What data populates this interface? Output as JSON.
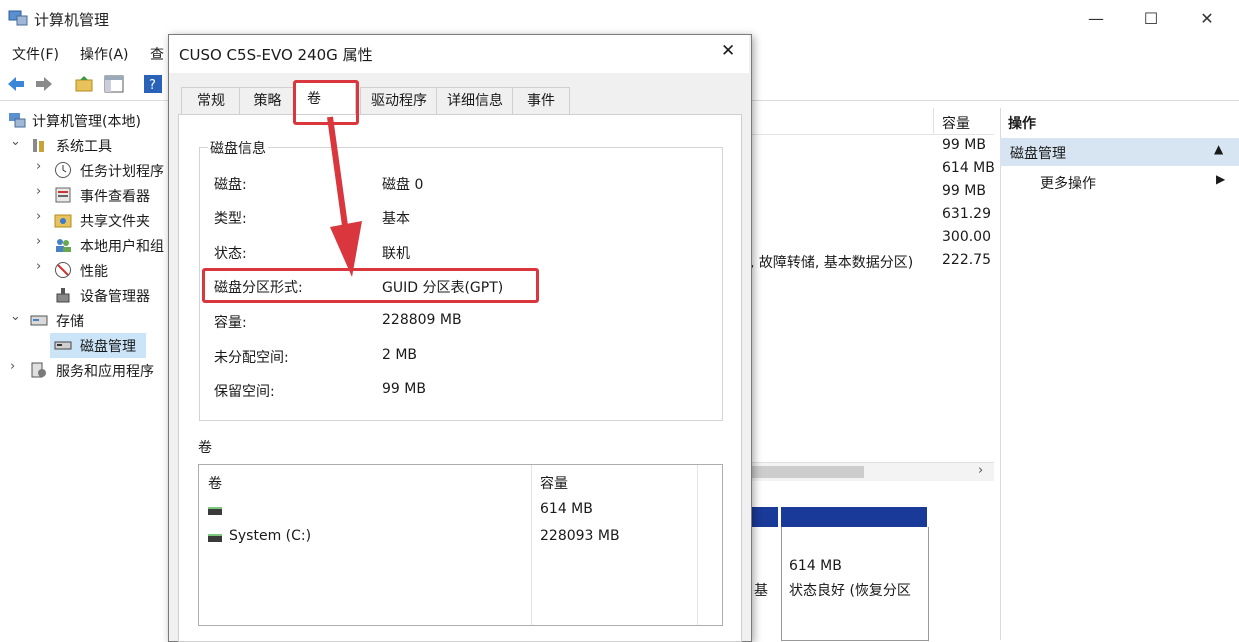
{
  "window": {
    "title": "计算机管理",
    "controls": {
      "minimize": "—",
      "maximize": "☐",
      "close": "✕"
    }
  },
  "menu": {
    "file": "文件(F)",
    "action": "操作(A)",
    "view_partial": "查"
  },
  "tree": [
    {
      "label": "计算机管理(本地)",
      "expand": ""
    },
    {
      "label": "系统工具",
      "expand": "⌄"
    },
    {
      "label": "任务计划程序",
      "expand": "›"
    },
    {
      "label": "事件查看器",
      "expand": "›"
    },
    {
      "label": "共享文件夹",
      "expand": "›"
    },
    {
      "label": "本地用户和组",
      "expand": "›"
    },
    {
      "label": "性能",
      "expand": "›"
    },
    {
      "label": "设备管理器",
      "expand": ""
    },
    {
      "label": "存储",
      "expand": "⌄"
    },
    {
      "label": "磁盘管理",
      "expand": ""
    },
    {
      "label": "服务和应用程序",
      "expand": "›"
    }
  ],
  "list": {
    "col_capacity": "容量",
    "capacities": [
      "99 MB",
      "614 MB",
      "99 MB",
      "631.29",
      "300.00",
      "222.75"
    ],
    "status_fragment": ", 故障转储, 基本数据分区)"
  },
  "actions": {
    "header": "操作",
    "section": "磁盘管理",
    "more": "更多操作"
  },
  "disk_map": {
    "left_fragment": "基",
    "partition_size": "614 MB",
    "partition_status": "状态良好 (恢复分区"
  },
  "dialog": {
    "title": "CUSO C5S-EVO 240G 属性",
    "tabs": [
      "常规",
      "策略",
      "卷",
      "驱动程序",
      "详细信息",
      "事件"
    ],
    "disk_info_title": "磁盘信息",
    "fields": [
      {
        "label": "磁盘:",
        "value": "磁盘 0"
      },
      {
        "label": "类型:",
        "value": "基本"
      },
      {
        "label": "状态:",
        "value": "联机"
      },
      {
        "label": "磁盘分区形式:",
        "value": "GUID 分区表(GPT)"
      },
      {
        "label": "容量:",
        "value": "228809 MB"
      },
      {
        "label": "未分配空间:",
        "value": "2 MB"
      },
      {
        "label": "保留空间:",
        "value": "99 MB"
      }
    ],
    "volumes_title": "卷",
    "volume_table": {
      "headers": [
        "卷",
        "容量"
      ],
      "rows": [
        {
          "name": "",
          "capacity": "614 MB"
        },
        {
          "name": "System (C:)",
          "capacity": "228093 MB"
        }
      ]
    }
  },
  "annotation_color": "#d9363e",
  "accent": "#1a3a9a"
}
